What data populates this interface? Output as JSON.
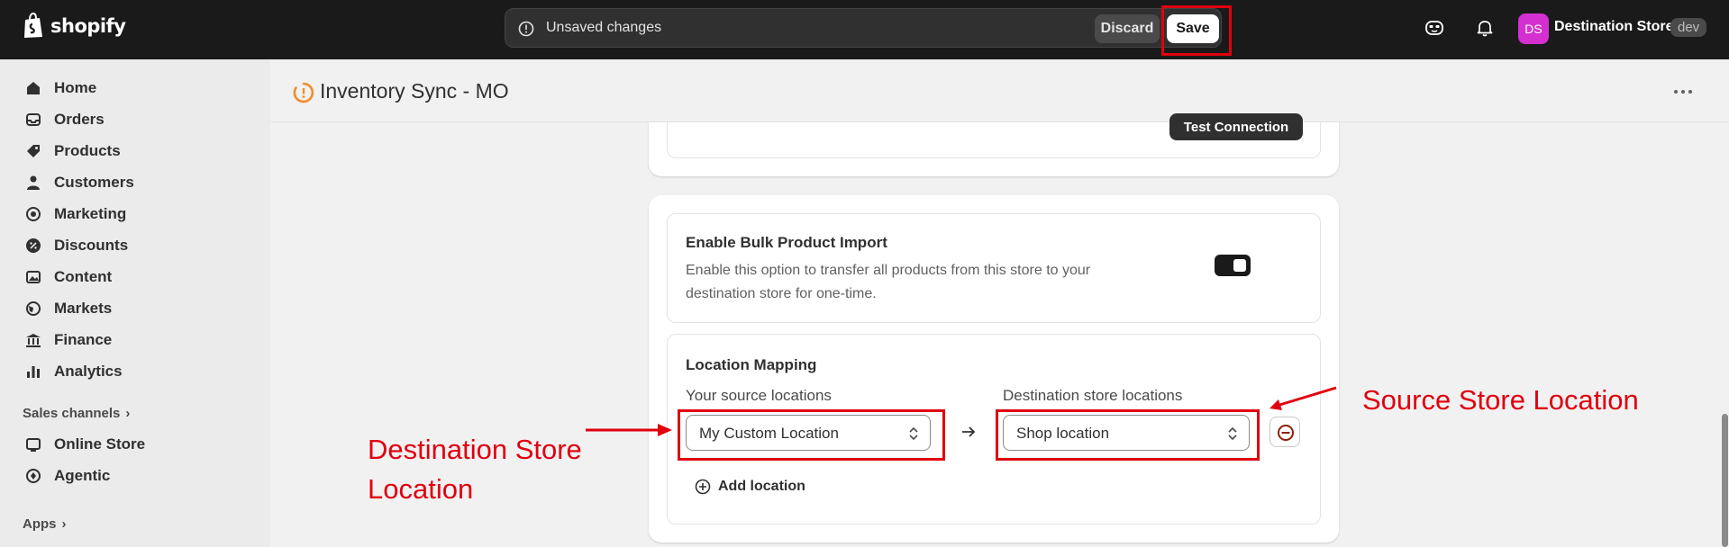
{
  "topbar": {
    "brand": "shopify",
    "savebar_message": "Unsaved changes",
    "discard_label": "Discard",
    "save_label": "Save",
    "store_initials": "DS",
    "store_name": "Destination Store",
    "store_badge": "dev"
  },
  "sidebar": {
    "items": [
      {
        "label": "Home",
        "icon": "home-icon"
      },
      {
        "label": "Orders",
        "icon": "inbox-icon"
      },
      {
        "label": "Products",
        "icon": "tag-icon"
      },
      {
        "label": "Customers",
        "icon": "person-icon"
      },
      {
        "label": "Marketing",
        "icon": "target-icon"
      },
      {
        "label": "Discounts",
        "icon": "discount-icon"
      },
      {
        "label": "Content",
        "icon": "image-icon"
      },
      {
        "label": "Markets",
        "icon": "globe-icon"
      },
      {
        "label": "Finance",
        "icon": "bank-icon"
      },
      {
        "label": "Analytics",
        "icon": "bar-chart-icon"
      }
    ],
    "sales_channels_label": "Sales channels",
    "channels": [
      {
        "label": "Online Store",
        "icon": "store-icon"
      },
      {
        "label": "Agentic",
        "icon": "agent-icon"
      }
    ],
    "apps_label": "Apps"
  },
  "app": {
    "title": "Inventory Sync - MO"
  },
  "connection_card": {
    "test_button": "Test Connection"
  },
  "bulk_import": {
    "title": "Enable Bulk Product Import",
    "description": "Enable this option to transfer all products from this store to your destination store for one-time.",
    "enabled": true
  },
  "location_mapping": {
    "title": "Location Mapping",
    "source_label": "Your source locations",
    "destination_label": "Destination store locations",
    "source_value": "My Custom Location",
    "destination_value": "Shop location",
    "add_label": "Add location"
  },
  "annotations": {
    "left_line1": "Destination Store",
    "left_line2": "Location",
    "right": "Source Store Location"
  },
  "colors": {
    "topbar": "#1a1a1a",
    "annotation_red": "#e0000f",
    "avatar": "#d42fd0"
  }
}
